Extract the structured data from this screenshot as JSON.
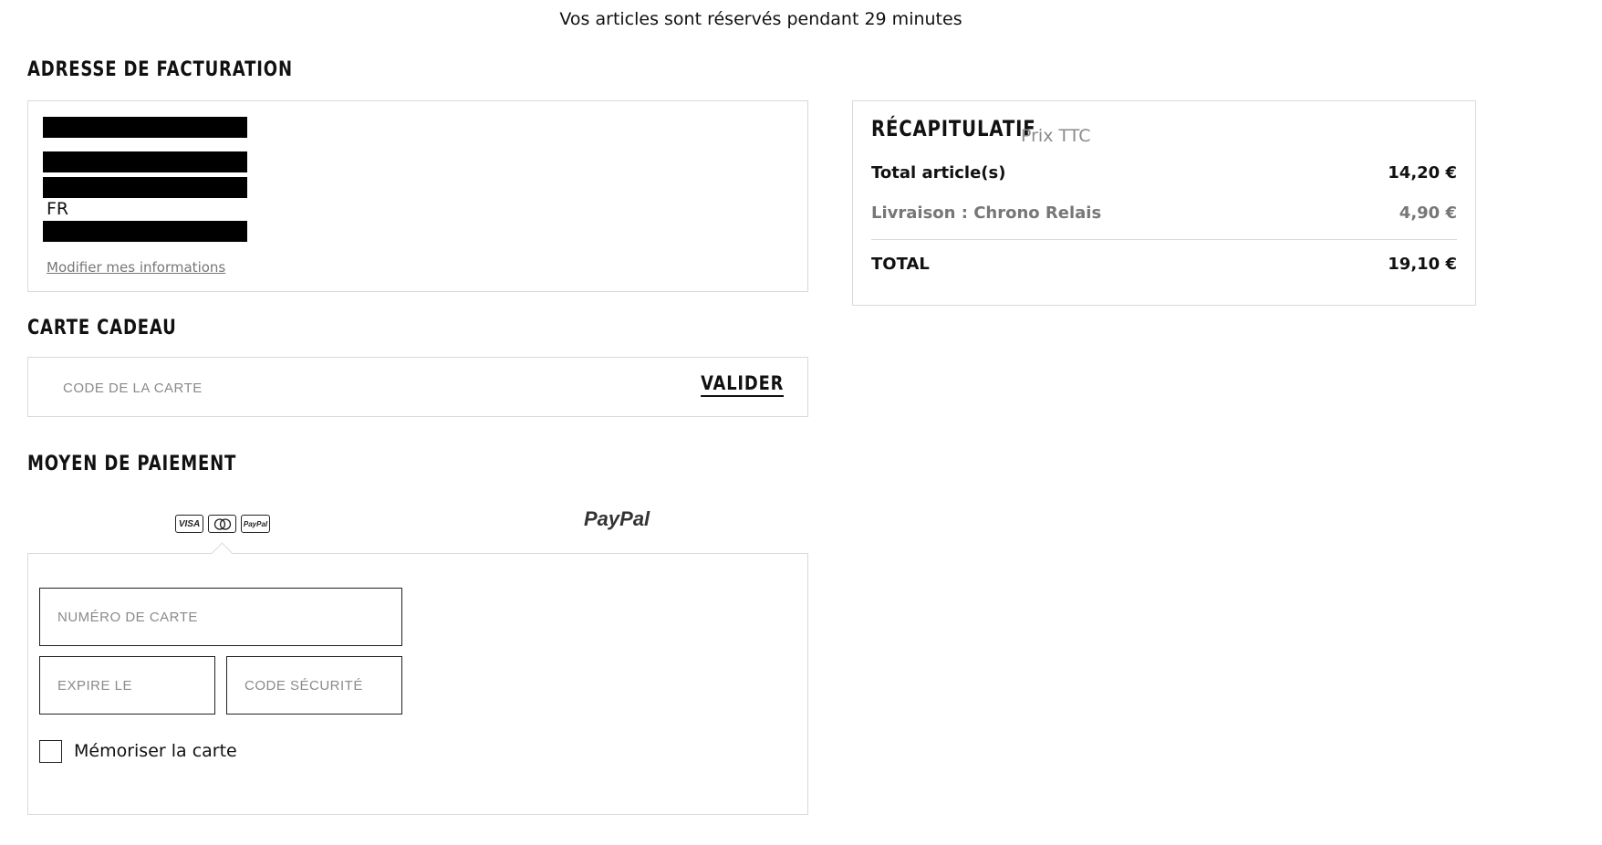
{
  "header": {
    "reservation_notice": "Vos articles sont réservés pendant 29 minutes"
  },
  "billing": {
    "title": "ADRESSE DE FACTURATION",
    "country": "FR",
    "edit_link": "Modifier mes informations"
  },
  "gift_card": {
    "title": "CARTE CADEAU",
    "placeholder": "CODE DE LA CARTE",
    "submit_label": "VALIDER"
  },
  "payment": {
    "title": "MOYEN DE PAIEMENT",
    "card_logos": [
      "VISA",
      "mastercard-icon",
      "PayPal"
    ],
    "paypal_tab_label": "PayPal",
    "card_number_placeholder": "NUMÉRO DE CARTE",
    "expiry_placeholder": "EXPIRE LE",
    "cvc_placeholder": "CODE SÉCURITÉ",
    "remember_label": "Mémoriser la carte"
  },
  "summary": {
    "title": "RÉCAPITULATIF",
    "subtitle": "Prix TTC",
    "items_label": "Total article(s)",
    "items_value": "14,20 €",
    "delivery_label": "Livraison : Chrono Relais",
    "delivery_value": "4,90 €",
    "total_label": "TOTAL",
    "total_value": "19,10 €"
  }
}
